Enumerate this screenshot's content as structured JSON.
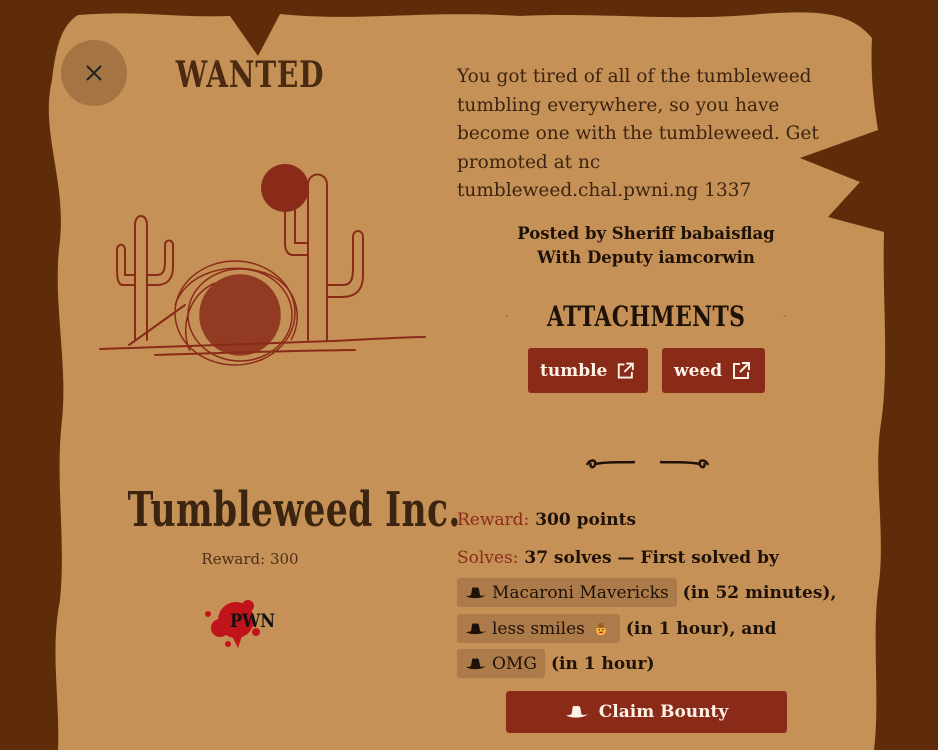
{
  "close": {
    "icon": "close-icon"
  },
  "bounty": {
    "wanted": "WANTED",
    "title": "Tumbleweed Inc.",
    "reward_text": "Reward: 300",
    "stamp_text": "PWN"
  },
  "description": "You got tired of all of the tumbleweed tumbling everywhere, so you have become one with the tumbleweed. Get promoted at nc tumbleweed.chal.pwni.ng 1337",
  "posted_by": "Posted by Sheriff babaisflag",
  "deputy": "With Deputy iamcorwin",
  "attachments": {
    "heading": "ATTACHMENTS",
    "items": [
      {
        "label": "tumble",
        "icon": "external-link-icon"
      },
      {
        "label": "weed",
        "icon": "external-link-icon"
      }
    ]
  },
  "reward": {
    "label": "Reward:",
    "value": "300 points"
  },
  "solves": {
    "label": "Solves:",
    "text": "37 solves — First solved by",
    "entries": [
      {
        "team": "Macaroni Mavericks",
        "after": "(in 52 minutes),",
        "icon": "cowboy-hat-icon"
      },
      {
        "team": "less smiles",
        "after": "(in 1 hour), and",
        "icon": "cowboy-hat-icon",
        "emoji": "cowboy-face-emoji"
      },
      {
        "team": "OMG",
        "after": "(in 1 hour)",
        "icon": "cowboy-hat-icon"
      }
    ]
  },
  "claim": {
    "label": "Claim Bounty",
    "icon": "cowboy-hat-icon"
  },
  "colors": {
    "background": "#5e2c08",
    "paper": "#c69156",
    "accent": "#8a2b1a",
    "chip": "#ad7b49",
    "text": "#1e1208"
  }
}
